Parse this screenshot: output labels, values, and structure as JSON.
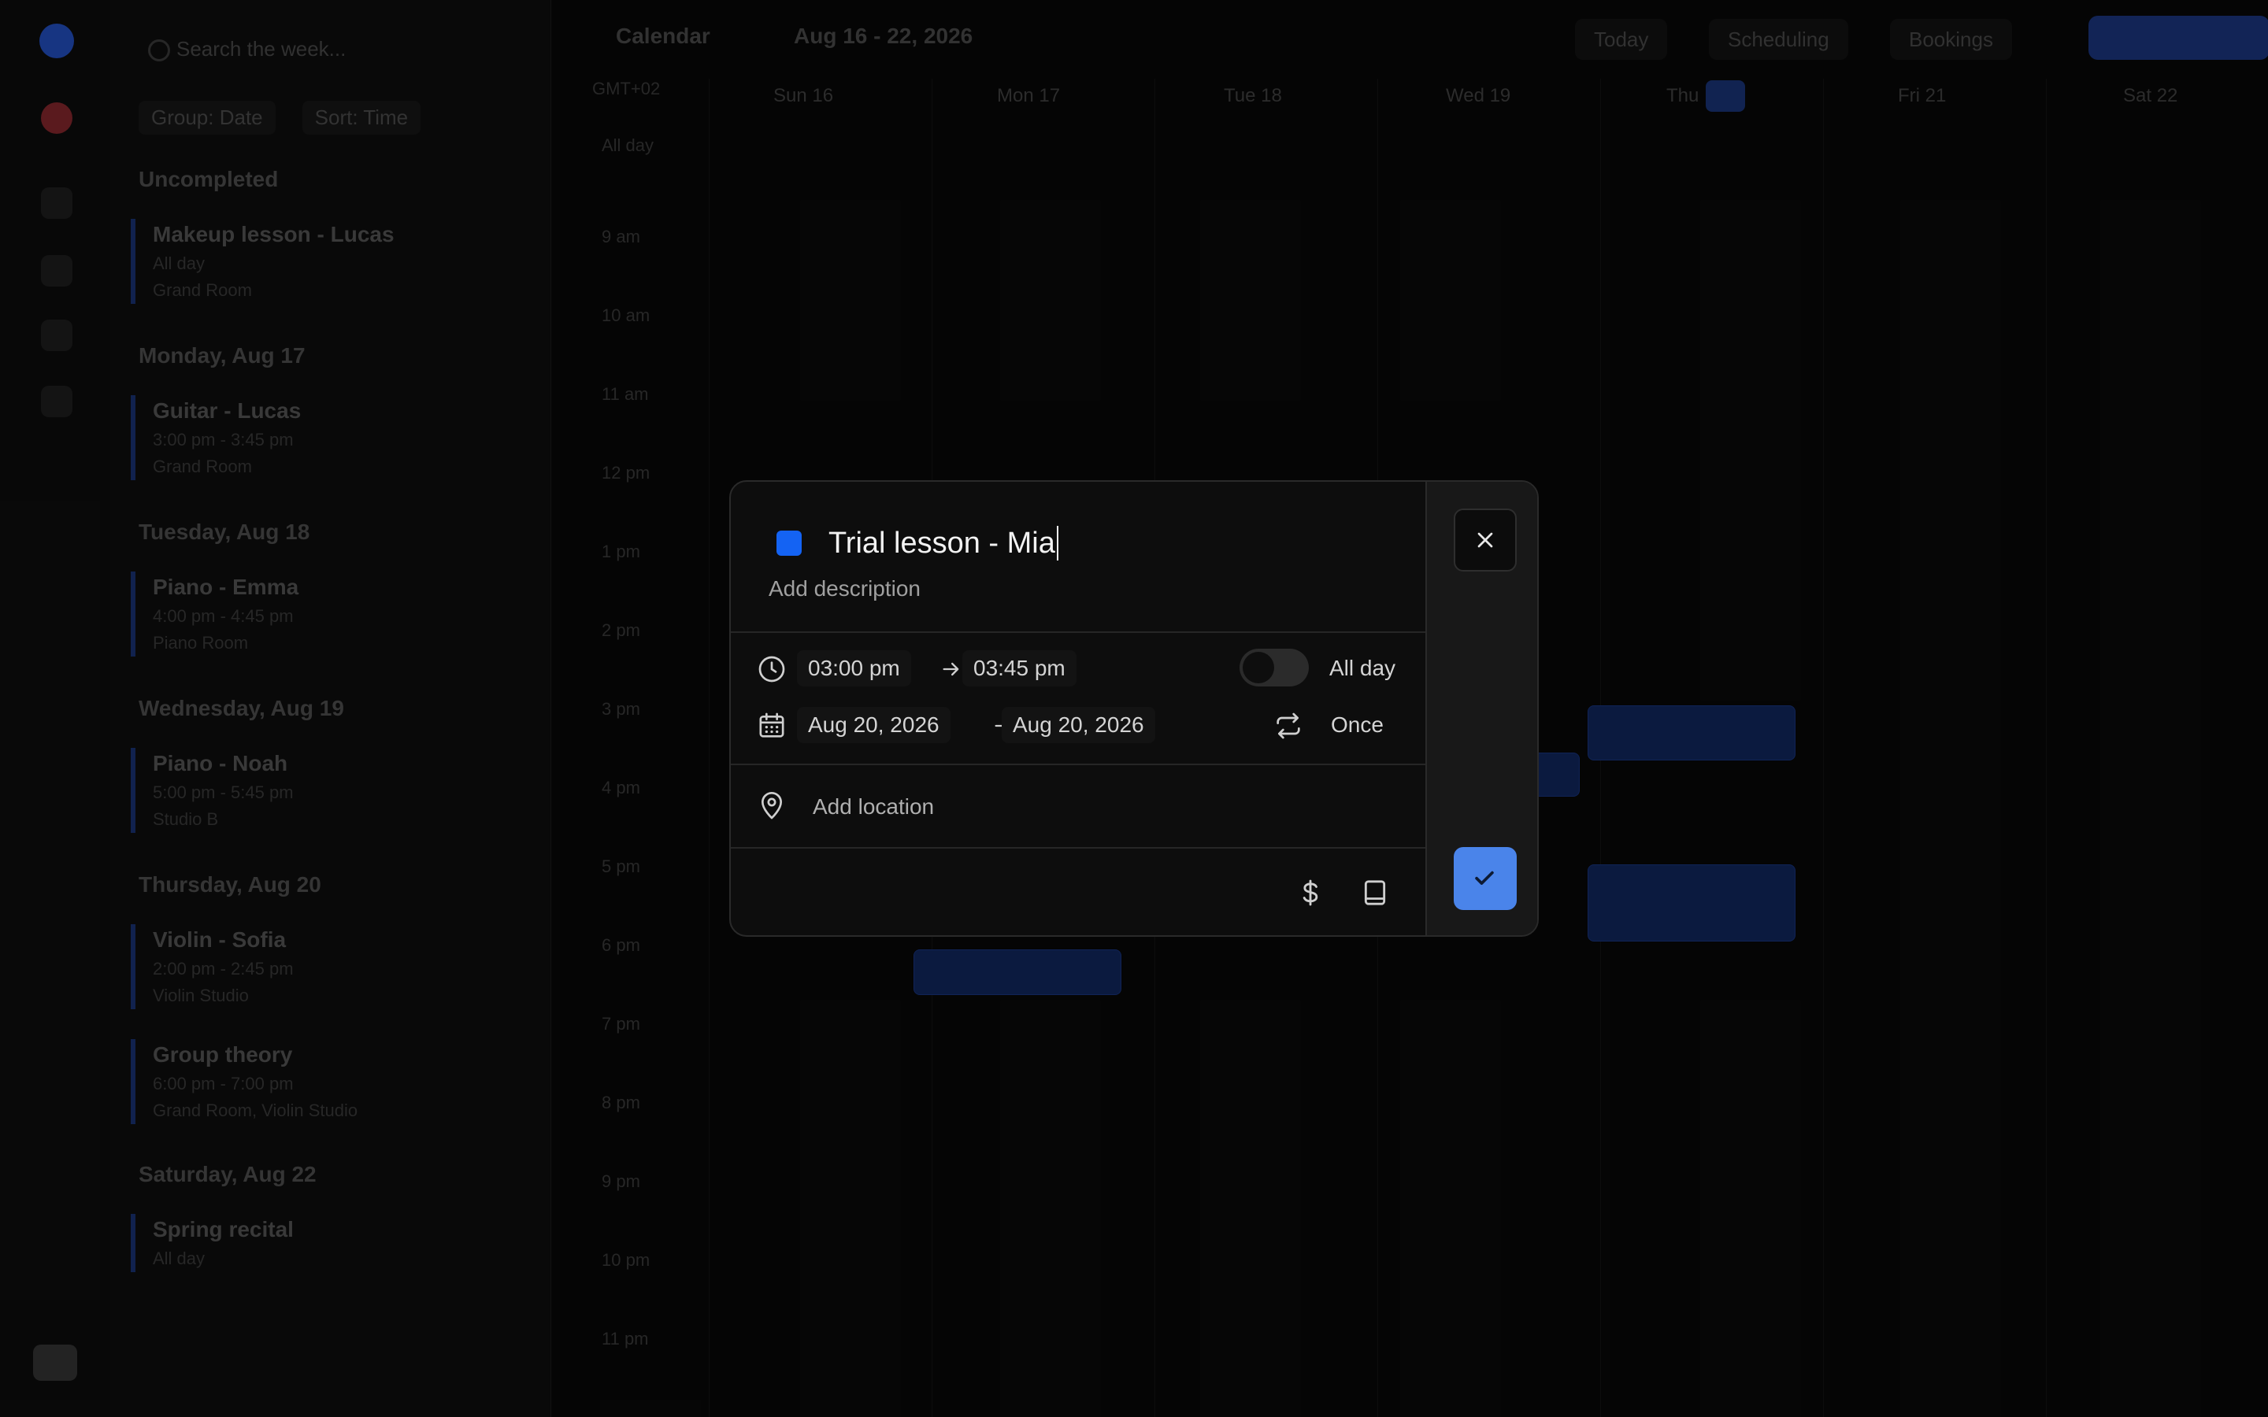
{
  "background": {
    "search_placeholder": "Search the week...",
    "filters": [
      "Group: Date",
      "Sort: Time"
    ],
    "agenda": [
      {
        "day": "Uncompleted",
        "events": [
          {
            "title": "Makeup lesson - Lucas",
            "sub1": "All day",
            "sub2": "Grand Room"
          }
        ]
      },
      {
        "day": "Monday, Aug 17",
        "events": [
          {
            "title": "Guitar - Lucas",
            "sub1": "3:00 pm - 3:45 pm",
            "sub2": "Grand Room"
          }
        ]
      },
      {
        "day": "Tuesday, Aug 18",
        "events": [
          {
            "title": "Piano - Emma",
            "sub1": "4:00 pm - 4:45 pm",
            "sub2": "Piano Room"
          }
        ]
      },
      {
        "day": "Wednesday, Aug 19",
        "events": [
          {
            "title": "Piano - Noah",
            "sub1": "5:00 pm - 5:45 pm",
            "sub2": "Studio B"
          }
        ]
      },
      {
        "day": "Thursday, Aug 20",
        "events": [
          {
            "title": "Violin - Sofia",
            "sub1": "2:00 pm - 2:45 pm",
            "sub2": "Violin Studio"
          },
          {
            "title": "Group theory",
            "sub1": "6:00 pm - 7:00 pm",
            "sub2": "Grand Room, Violin Studio"
          }
        ]
      },
      {
        "day": "Saturday, Aug 22",
        "events": [
          {
            "title": "Spring recital",
            "sub1": "All day",
            "sub2": ""
          }
        ]
      }
    ],
    "calendar": {
      "crumbs": [
        "Calendar",
        "Aug 16 - 22, 2026"
      ],
      "today_label": "Today",
      "btn_scheduling": "Scheduling",
      "btn_bookings": "Bookings",
      "timezone": "GMT+02",
      "days": [
        "Sun 16",
        "Mon 17",
        "Tue 18",
        "Wed 19",
        "Thu",
        "Fri 21",
        "Sat 22"
      ],
      "today_num": "20",
      "hours": [
        "All day",
        "9 am",
        "10 am",
        "11 am",
        "12 pm",
        "1 pm",
        "2 pm",
        "3 pm",
        "4 pm",
        "5 pm",
        "6 pm",
        "7 pm",
        "8 pm",
        "9 pm",
        "10 pm",
        "11 pm"
      ]
    }
  },
  "modal": {
    "color": "#1463f3",
    "title_value": "Trial lesson - Mia",
    "description_placeholder": "Add description",
    "start_time": "03:00 pm",
    "end_time": "03:45 pm",
    "all_day_label": "All day",
    "all_day_on": false,
    "start_date": "Aug 20, 2026",
    "end_date": "Aug 20, 2026",
    "repeat": "Once",
    "location_placeholder": "Add location",
    "icons": [
      "clock-icon",
      "calendar-icon",
      "repeat-icon",
      "location-pin-icon",
      "dollar-icon",
      "book-icon",
      "close-icon",
      "check-icon",
      "arrow-right-icon"
    ]
  }
}
